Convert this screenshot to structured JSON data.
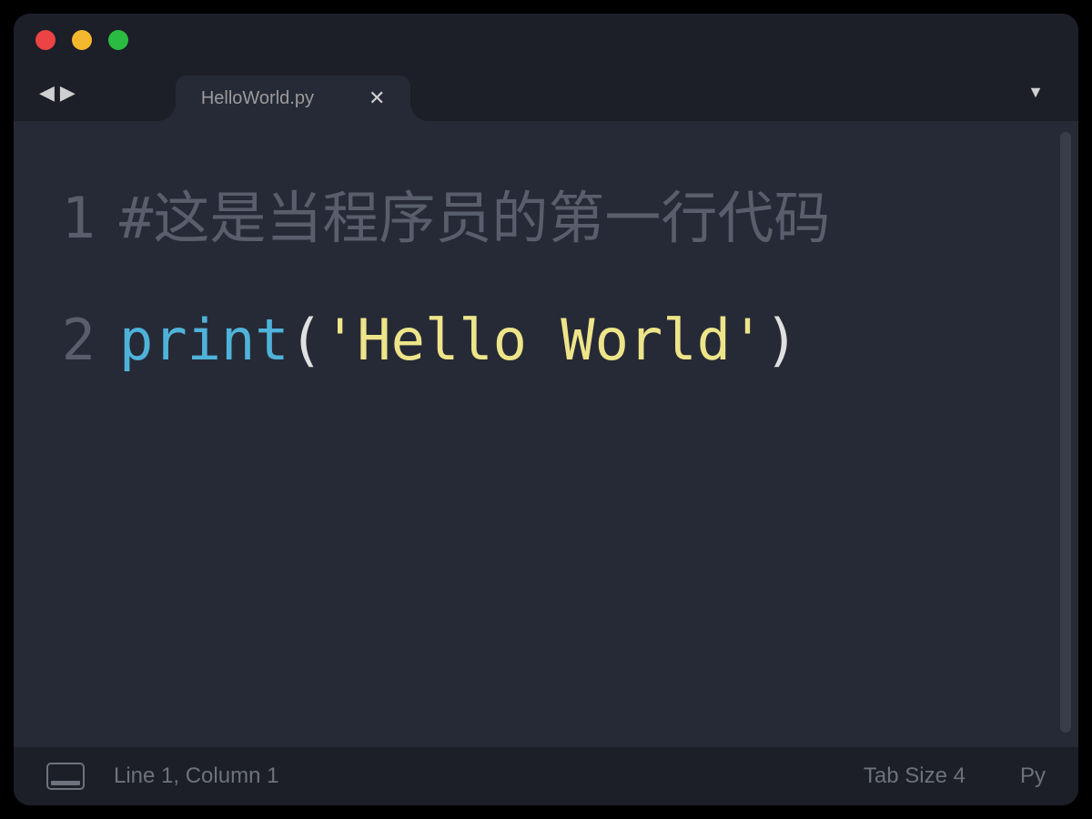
{
  "tab": {
    "filename": "HelloWorld.py"
  },
  "code": {
    "lines": [
      {
        "num": "1",
        "type": "comment",
        "text": "#这是当程序员的第一行代码"
      },
      {
        "num": "2",
        "type": "call",
        "keyword": "print",
        "lparen": "(",
        "string": "'Hello World'",
        "rparen": ")"
      }
    ]
  },
  "status": {
    "cursor": "Line 1, Column 1",
    "tab_size": "Tab Size 4",
    "language": "Py"
  }
}
